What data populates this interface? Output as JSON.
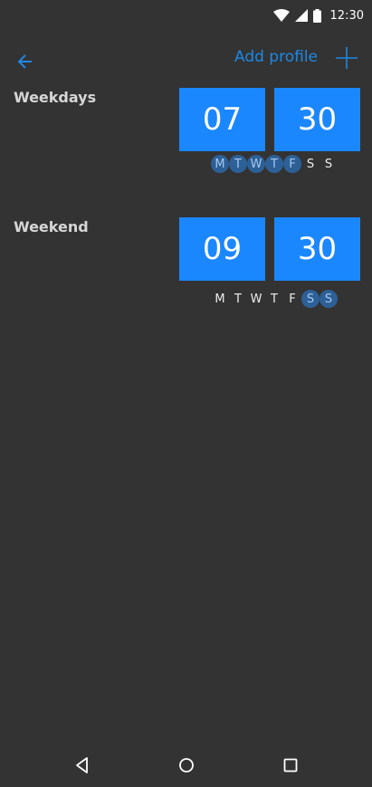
{
  "status_bar": {
    "time": "12:30",
    "icons": [
      "wifi-icon",
      "signal-icon",
      "battery-icon"
    ]
  },
  "top_bar": {
    "back_icon": "arrow-left-icon",
    "add_profile_label": "Add profile",
    "add_icon": "plus-icon"
  },
  "profiles": [
    {
      "name": "Weekdays",
      "hour": "07",
      "minute": "30",
      "days": [
        {
          "label": "M",
          "active": true
        },
        {
          "label": "T",
          "active": true
        },
        {
          "label": "W",
          "active": true
        },
        {
          "label": "T",
          "active": true
        },
        {
          "label": "F",
          "active": true
        },
        {
          "label": "S",
          "active": false
        },
        {
          "label": "S",
          "active": false
        }
      ]
    },
    {
      "name": "Weekend",
      "hour": "09",
      "minute": "30",
      "days": [
        {
          "label": "M",
          "active": false
        },
        {
          "label": "T",
          "active": false
        },
        {
          "label": "W",
          "active": false
        },
        {
          "label": "T",
          "active": false
        },
        {
          "label": "F",
          "active": false
        },
        {
          "label": "S",
          "active": true
        },
        {
          "label": "S",
          "active": true
        }
      ]
    }
  ],
  "nav_bar": {
    "icons": [
      "back-triangle-icon",
      "home-circle-icon",
      "recents-square-icon"
    ]
  },
  "colors": {
    "background": "#333333",
    "accent": "#1a87ff",
    "link": "#1e88e5",
    "day_active_bg": "#2d6096"
  }
}
